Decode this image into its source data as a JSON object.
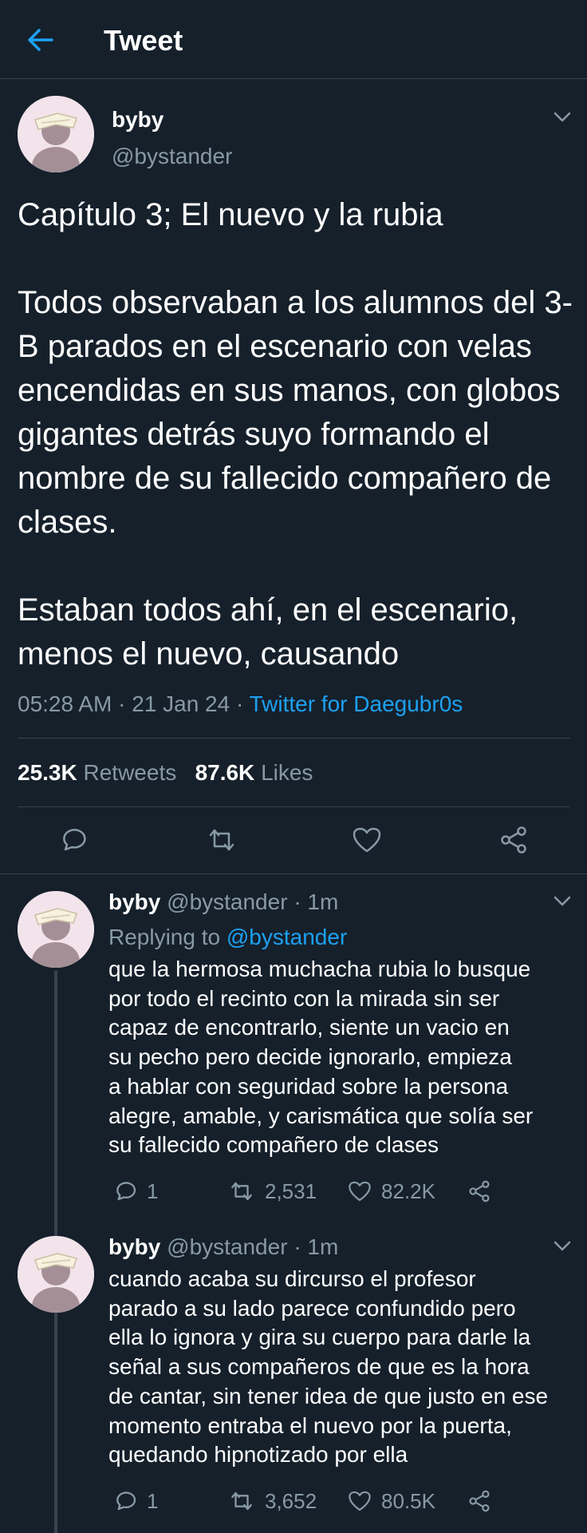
{
  "header": {
    "title": "Tweet"
  },
  "icons": {
    "back": "arrow-left-icon",
    "more": "chevron-down-icon",
    "reply": "comment-icon",
    "retweet": "retweet-icon",
    "like": "heart-icon",
    "share": "share-icon"
  },
  "colors": {
    "background": "#15202b",
    "accent": "#1da1f2",
    "muted": "#8899a6",
    "divider": "#38444d"
  },
  "tweet": {
    "author_name": "byby",
    "author_handle": "@bystander",
    "text": "Capítulo 3; El nuevo y la rubia\n\nTodos observaban a los alumnos del 3-B parados en el escenario con velas encendidas en sus manos, con globos gigantes detrás suyo formando el nombre de su fallecido compañero de clases.\n\nEstaban todos ahí, en el escenario, menos el nuevo, causando",
    "time": "05:28 AM",
    "date": "21 Jan 24",
    "separator": "·",
    "source": "Twitter for Daegubr0s",
    "retweets_count": "25.3K",
    "retweets_label": "Retweets",
    "likes_count": "87.6K",
    "likes_label": "Likes"
  },
  "replies": [
    {
      "author_name": "byby",
      "author_handle": "@bystander",
      "time_ago": "· 1m",
      "replying_to_label": "Replying to",
      "replying_to_handle": "@bystander",
      "text": "que la hermosa muchacha rubia lo busque\npor todo el recinto con la mirada sin ser\ncapaz de encontrarlo, siente un vacio en\nsu pecho pero decide ignorarlo, empieza\na hablar con seguridad sobre la persona\nalegre, amable, y carismática que solía ser\nsu fallecido compañero de clases",
      "reply_count": "1",
      "retweet_count": "2,531",
      "like_count": "82.2K"
    },
    {
      "author_name": "byby",
      "author_handle": "@bystander",
      "time_ago": "· 1m",
      "text": "cuando acaba su dircurso el profesor\nparado a su lado parece confundido pero\nella lo ignora y gira su cuerpo para darle la\nseñal a sus compañeros de que es la hora\nde cantar, sin tener idea de que justo en ese\nmomento entraba el nuevo por la puerta,\nquedando hipnotizado por ella",
      "reply_count": "1",
      "retweet_count": "3,652",
      "like_count": "80.5K"
    }
  ]
}
